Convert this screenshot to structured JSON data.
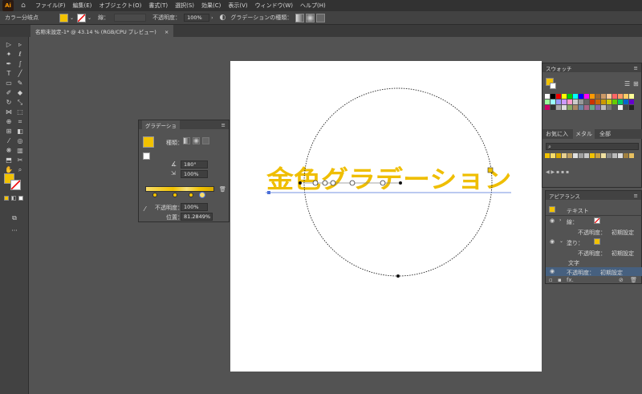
{
  "app": {
    "logo": "Ai",
    "home_icon": "home-icon"
  },
  "menu": [
    "ファイル(F)",
    "編集(E)",
    "オブジェクト(O)",
    "書式(T)",
    "選択(S)",
    "効果(C)",
    "表示(V)",
    "ウィンドウ(W)",
    "ヘルプ(H)"
  ],
  "control_bar": {
    "context_label": "カラー分岐点",
    "stroke_label": "線：",
    "opacity_label": "不透明度：",
    "opacity_value": "100%",
    "gradient_type_label": "グラデーションの種類："
  },
  "document": {
    "tab_label": "名称未設定-1* @ 43.14 % (RGB/CPU プレビュー)",
    "close": "×"
  },
  "artwork": {
    "text": "金色グラデーション"
  },
  "gradient_panel": {
    "tab": "グラデーショ",
    "type_label": "種類：",
    "angle_value": "180°",
    "aspect_value": "100%",
    "opacity_label": "不透明度：",
    "opacity_value": "100%",
    "location_label": "位置：",
    "location_value": "81.2849%"
  },
  "swatches_panel": {
    "tab": "スウォッチ",
    "sub_tabs": [
      "お気に入",
      "メタル",
      "全部"
    ]
  },
  "appearance_panel": {
    "tab": "アピアランス",
    "object_label": "テキスト",
    "stroke_label": "線：",
    "opacity1_label": "不透明度：",
    "opacity1_value": "初期設定",
    "fill_label": "塗り：",
    "opacity2_label": "不透明度：",
    "opacity2_value": "初期設定",
    "characters_label": "文字",
    "opacity3_label": "不透明度：",
    "opacity3_value": "初期設定",
    "fx_label": "fx."
  },
  "colors": {
    "accent_gold": "#f2c200",
    "gold_light": "#f8dd6a",
    "selection_blue": "#4a6fd8",
    "highlight_row": "#46607f"
  }
}
